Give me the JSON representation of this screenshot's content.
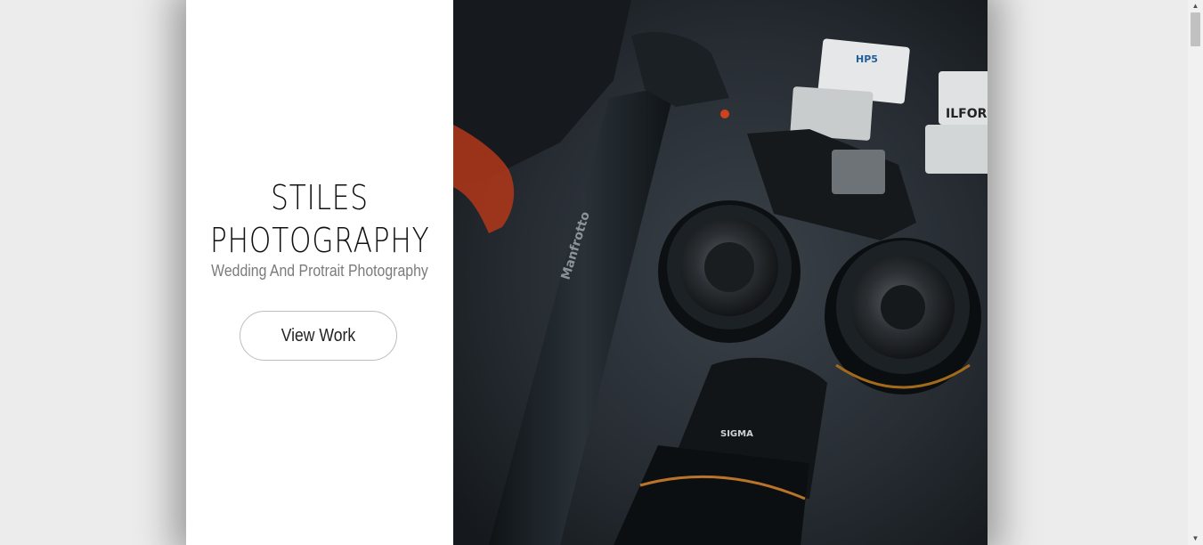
{
  "hero": {
    "title_line1": "STILES",
    "title_line2": "PHOTOGRAPHY",
    "tagline": "Wedding And Protrait Photography",
    "cta_label": "View Work"
  },
  "photo": {
    "tripod_text": "Manfrotto",
    "lens_brand": "SIGMA",
    "film_brand": "ILFORD",
    "film_label": "HP5",
    "alt": "Camera gear flat lay"
  },
  "colors": {
    "page_bg": "#ececec",
    "panel_bg": "#ffffff",
    "title": "#111111",
    "tagline": "#7b7b7b",
    "photo_bg": "#22282e",
    "accent_strap": "#b3371a"
  },
  "scrollbar": {
    "up_icon": "triangle-up-icon",
    "down_icon": "triangle-down-icon"
  }
}
